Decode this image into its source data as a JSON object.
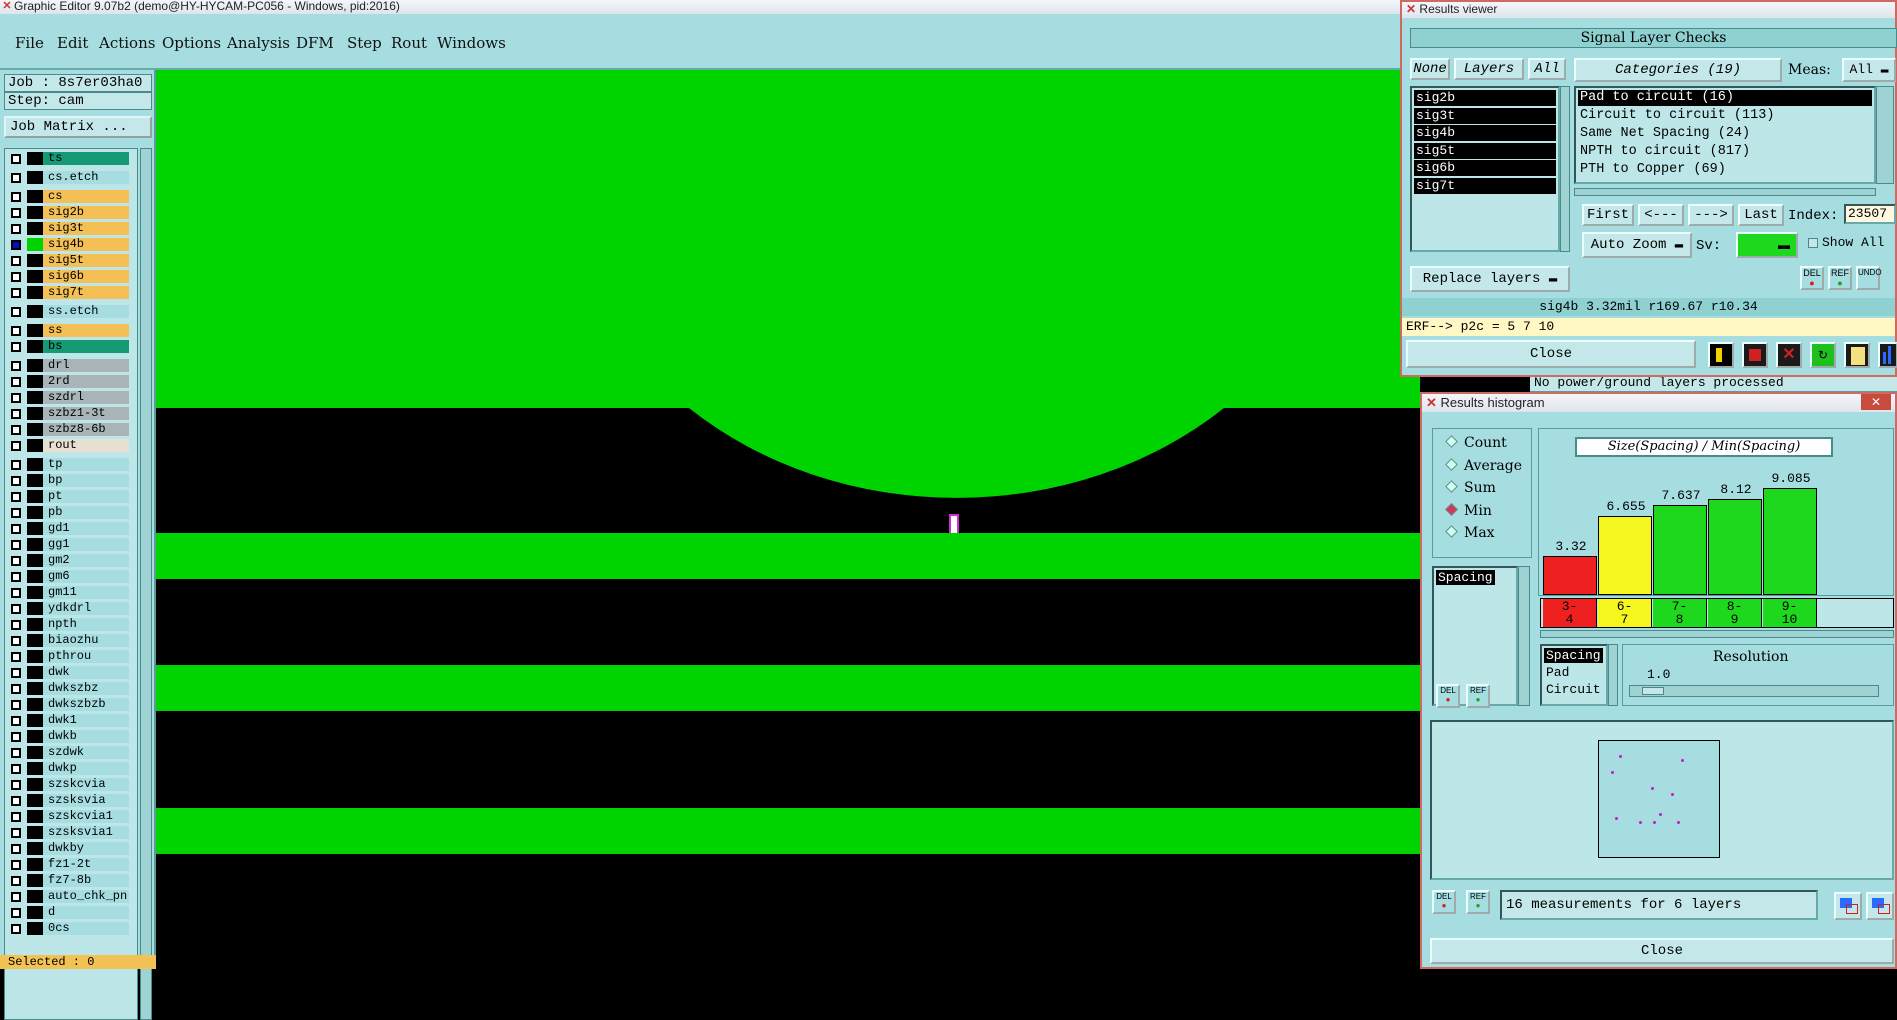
{
  "main": {
    "title": "Graphic Editor 9.07b2 (demo@HY-HYCAM-PC056 - Windows, pid:2016)",
    "menu": [
      "File",
      "Edit",
      "Actions",
      "Options",
      "Analysis",
      "DFM",
      "Step",
      "Rout",
      "Windows"
    ],
    "job": "Job : 8s7er03ha0",
    "step": "Step: cam",
    "job_matrix": "Job Matrix ...",
    "selected": "Selected : 0",
    "layers": [
      {
        "name": "ts",
        "color": "#159a75"
      },
      {
        "name": "cs.etch",
        "color": "#a6dde0"
      },
      {
        "name": "cs",
        "color": "#f4bf54"
      },
      {
        "name": "sig2b",
        "color": "#f4bf54"
      },
      {
        "name": "sig3t",
        "color": "#f4bf54"
      },
      {
        "name": "sig4b",
        "color": "#f4bf54",
        "active": true
      },
      {
        "name": "sig5t",
        "color": "#f4bf54"
      },
      {
        "name": "sig6b",
        "color": "#f4bf54"
      },
      {
        "name": "sig7t",
        "color": "#f4bf54"
      },
      {
        "name": "ss.etch",
        "color": "#a6dde0"
      },
      {
        "name": "ss",
        "color": "#f4bf54"
      },
      {
        "name": "bs",
        "color": "#159a75"
      },
      {
        "name": "drl",
        "color": "#a8b4b8"
      },
      {
        "name": "2rd",
        "color": "#a8b4b8"
      },
      {
        "name": "szdrl",
        "color": "#a8b4b8"
      },
      {
        "name": "szbz1-3t",
        "color": "#a8b4b8"
      },
      {
        "name": "szbz8-6b",
        "color": "#a8b4b8"
      },
      {
        "name": "rout",
        "color": "#e8e0d0"
      },
      {
        "name": "tp",
        "color": "#a6dde0"
      },
      {
        "name": "bp",
        "color": "#a6dde0"
      },
      {
        "name": "pt",
        "color": "#a6dde0"
      },
      {
        "name": "pb",
        "color": "#a6dde0"
      },
      {
        "name": "gd1",
        "color": "#a6dde0"
      },
      {
        "name": "gg1",
        "color": "#a6dde0"
      },
      {
        "name": "gm2",
        "color": "#a6dde0"
      },
      {
        "name": "gm6",
        "color": "#a6dde0"
      },
      {
        "name": "gm11",
        "color": "#a6dde0"
      },
      {
        "name": "ydkdrl",
        "color": "#a6dde0"
      },
      {
        "name": "npth",
        "color": "#a6dde0"
      },
      {
        "name": "biaozhu",
        "color": "#a6dde0"
      },
      {
        "name": "pthrou",
        "color": "#a6dde0"
      },
      {
        "name": "dwk",
        "color": "#a6dde0"
      },
      {
        "name": "dwkszbz",
        "color": "#a6dde0"
      },
      {
        "name": "dwkszbzb",
        "color": "#a6dde0"
      },
      {
        "name": "dwk1",
        "color": "#a6dde0"
      },
      {
        "name": "dwkb",
        "color": "#a6dde0"
      },
      {
        "name": "szdwk",
        "color": "#a6dde0"
      },
      {
        "name": "dwkp",
        "color": "#a6dde0"
      },
      {
        "name": "szskcvia",
        "color": "#a6dde0"
      },
      {
        "name": "szsksvia",
        "color": "#a6dde0"
      },
      {
        "name": "szskcvia1",
        "color": "#a6dde0"
      },
      {
        "name": "szsksvia1",
        "color": "#a6dde0"
      },
      {
        "name": "dwkby",
        "color": "#a6dde0"
      },
      {
        "name": "fz1-2t",
        "color": "#a6dde0"
      },
      {
        "name": "fz7-8b",
        "color": "#a6dde0"
      },
      {
        "name": "auto_chk_pn",
        "color": "#a6dde0"
      },
      {
        "name": "d",
        "color": "#a6dde0"
      },
      {
        "name": "0cs",
        "color": "#a6dde0"
      }
    ]
  },
  "results_viewer": {
    "title": "Results viewer",
    "header": "Signal Layer Checks",
    "none_btn": "None",
    "layers_btn": "Layers",
    "all_btn": "All",
    "categories_btn": "Categories (19)",
    "meas_label": "Meas:",
    "meas_value": "All",
    "layers": [
      "sig2b",
      "sig3t",
      "sig4b",
      "sig5t",
      "sig6b",
      "sig7t"
    ],
    "categories": [
      "Pad to circuit (16)",
      "Circuit to circuit (113)",
      "Same Net Spacing (24)",
      "NPTH to circuit (817)",
      "PTH to Copper (69)"
    ],
    "first_btn": "First",
    "prev_btn": "<---",
    "next_btn": "--->",
    "last_btn": "Last",
    "index_label": "Index:",
    "index_value": "23507",
    "auto_zoom": "Auto Zoom",
    "sv_label": "Sv:",
    "show_all": "Show All",
    "replace_layers": "Replace layers",
    "status": "sig4b 3.32mil  r169.67  r10.34",
    "erf": "ERF--> p2c = 5 7 10",
    "close": "Close",
    "del": "DEL",
    "ref": "REF",
    "undo": "UNDO",
    "behind_text": "No power/ground layers processed"
  },
  "histogram": {
    "title": "Results histogram",
    "radios": [
      {
        "label": "Count",
        "on": false
      },
      {
        "label": "Average",
        "on": false
      },
      {
        "label": "Sum",
        "on": false
      },
      {
        "label": "Min",
        "on": true
      },
      {
        "label": "Max",
        "on": false
      }
    ],
    "list_item": "Spacing",
    "chart_title": "Size(Spacing) / Min(Spacing)",
    "bars": [
      {
        "label": "3.32",
        "value": 3.32,
        "color": "#ee2020",
        "range": "3-\n4"
      },
      {
        "label": "6.655",
        "value": 6.655,
        "color": "#f5f520",
        "range": "6-\n7"
      },
      {
        "label": "7.637",
        "value": 7.637,
        "color": "#1ed81e",
        "range": "7-\n8"
      },
      {
        "label": "8.12",
        "value": 8.12,
        "color": "#1ed81e",
        "range": "8-\n9"
      },
      {
        "label": "9.085",
        "value": 9.085,
        "color": "#1ed81e",
        "range": "9-\n10"
      }
    ],
    "type_list": [
      "Spacing",
      "Pad",
      "Circuit"
    ],
    "resolution_label": "Resolution",
    "resolution_value": "1.0",
    "measurements": "16 measurements for 6 layers",
    "close": "Close",
    "del": "DEL",
    "ref": "REF"
  }
}
